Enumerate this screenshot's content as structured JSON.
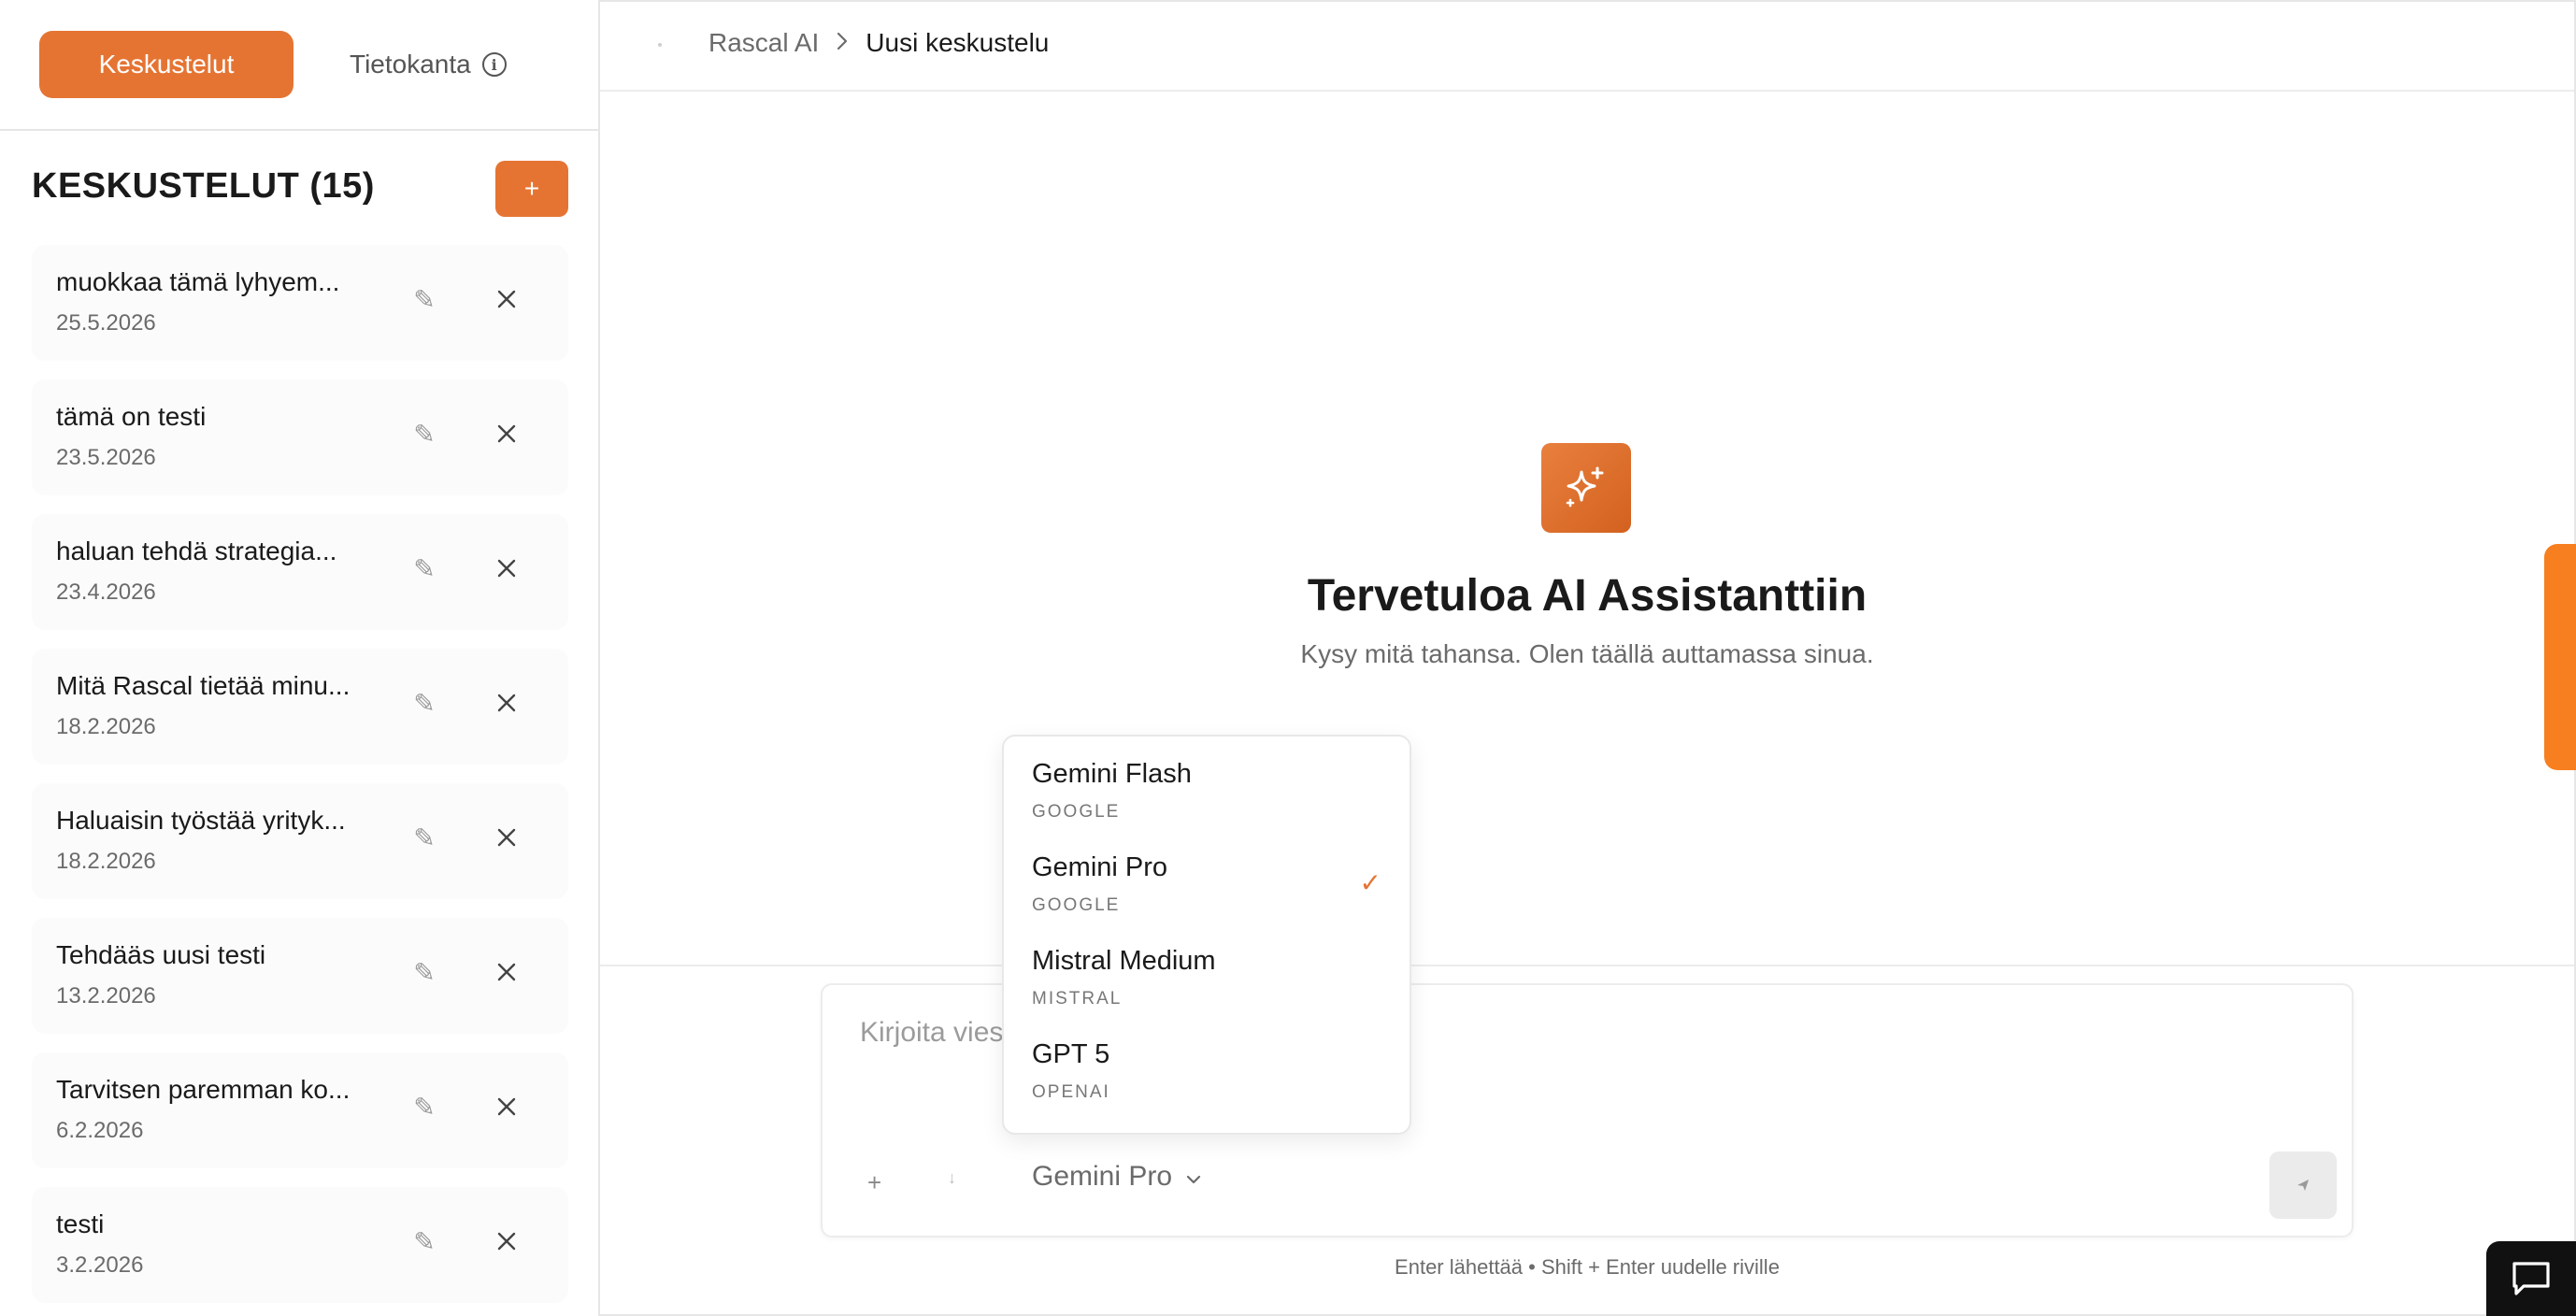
{
  "tabs": {
    "active": "Keskustelut",
    "inactive": "Tietokanta",
    "inactive_icon": "info-icon"
  },
  "sidebar": {
    "title": "KESKUSTELUT (15)",
    "add_label": "+",
    "items": [
      {
        "title": "muokkaa tämä lyhyem...",
        "date": "25.5.2026"
      },
      {
        "title": "tämä on testi",
        "date": "23.5.2026"
      },
      {
        "title": "haluan tehdä strategia...",
        "date": "23.4.2026"
      },
      {
        "title": "Mitä Rascal tietää minu...",
        "date": "18.2.2026"
      },
      {
        "title": "Haluaisin työstää yrityk...",
        "date": "18.2.2026"
      },
      {
        "title": "Tehdääs uusi testi",
        "date": "13.2.2026"
      },
      {
        "title": "Tarvitsen paremman ko...",
        "date": "6.2.2026"
      },
      {
        "title": "testi",
        "date": "3.2.2026"
      }
    ],
    "item_icons": {
      "edit": "pencil-icon",
      "delete": "close-icon"
    }
  },
  "breadcrumb": {
    "root": "Rascal AI",
    "separator": ">",
    "current": "Uusi keskustelu"
  },
  "welcome": {
    "icon": "sparkle-icon",
    "title": "Tervetuloa AI Assistanttiin",
    "subtitle": "Kysy mitä tahansa. Olen täällä auttamassa sinua."
  },
  "composer": {
    "placeholder": "Kirjoita viestisi...",
    "visible_placeholder": "Kirjoita vies",
    "plus_label": "+",
    "down_label": "↓",
    "model_selected": "Gemini Pro",
    "hint": "Enter lähettää • Shift + Enter uudelle riville"
  },
  "model_dropdown": {
    "options": [
      {
        "name": "Gemini Flash",
        "provider": "GOOGLE",
        "selected": false
      },
      {
        "name": "Gemini Pro",
        "provider": "GOOGLE",
        "selected": true
      },
      {
        "name": "Mistral Medium",
        "provider": "MISTRAL",
        "selected": false
      },
      {
        "name": "GPT 5",
        "provider": "OPENAI",
        "selected": false
      }
    ],
    "check_mark": "✓"
  },
  "colors": {
    "accent": "#e57433",
    "side_tab": "#f77f1f",
    "chat_widget": "#111111"
  }
}
